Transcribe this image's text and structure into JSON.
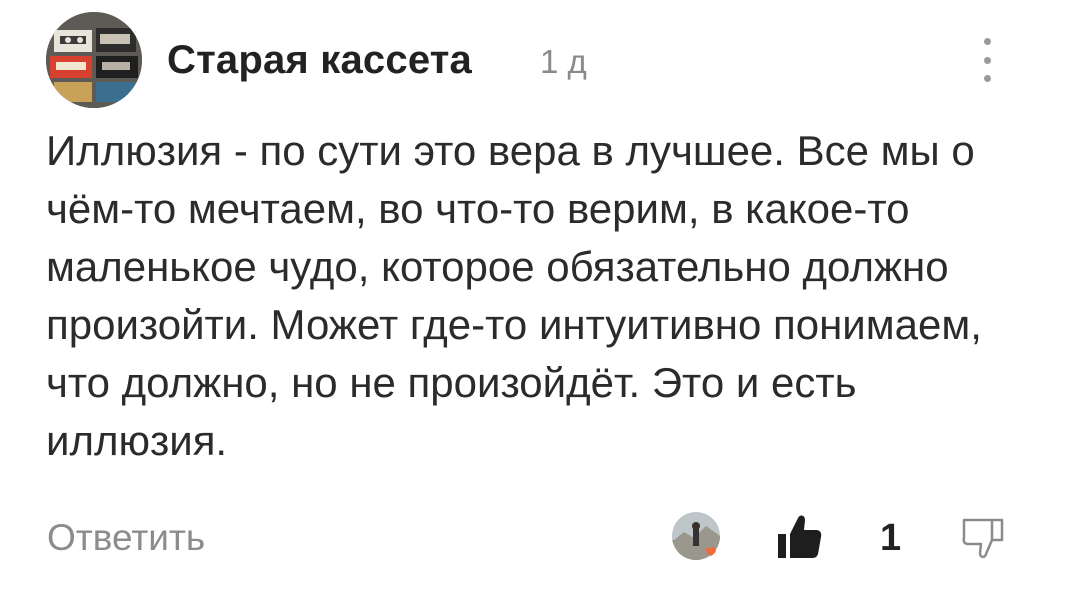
{
  "comment": {
    "author": "Старая кассета",
    "time": "1 д",
    "text": "Иллюзия - по сути это вера в лучшее. Все мы о чём-то мечтаем, во что-то верим, в какое-то маленькое чудо, которое обязательно должно произойти. Может где-то интуитивно понимаем, что должно, но не произойдёт. Это и есть иллюзия.",
    "reply_label": "Ответить",
    "like_count": "1"
  },
  "icons": {
    "avatar": "cassette-tapes-avatar",
    "more": "more-vertical-icon",
    "reactor": "reactor-avatar-heart",
    "like": "thumbs-up-icon",
    "dislike": "thumbs-down-icon"
  },
  "colors": {
    "heart": "#f26b3a",
    "muted": "#8c8c8c",
    "text": "#2b2b2b"
  }
}
